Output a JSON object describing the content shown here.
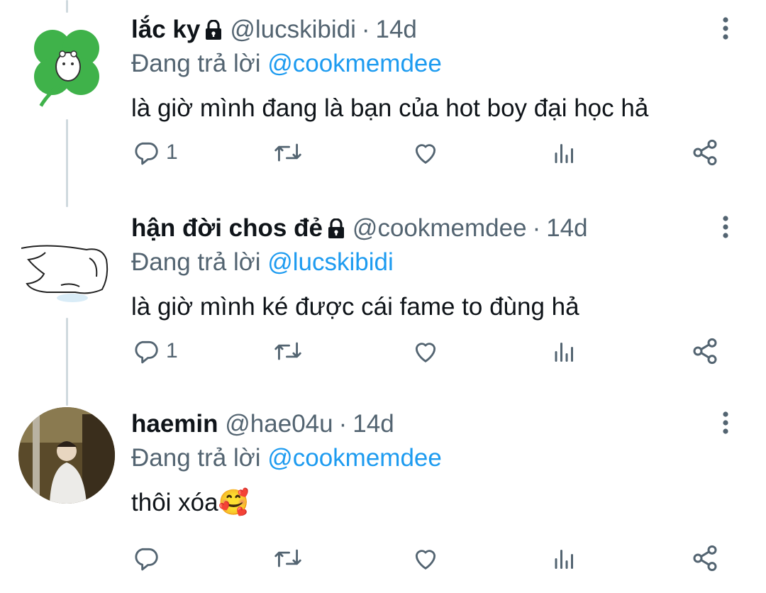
{
  "tweets": [
    {
      "name": "lắc ky",
      "locked": true,
      "handle": "@lucskibidi",
      "time": "14d",
      "reply_prefix": "Đang trả lời",
      "reply_to": "@cookmemdee",
      "text": "là giờ mình đang là bạn của hot boy đại học hả",
      "reply_count": "1",
      "avatar_icon": "clover-avatar-icon"
    },
    {
      "name": "hận đời chos đẻ",
      "locked": true,
      "handle": "@cookmemdee",
      "time": "14d",
      "reply_prefix": "Đang trả lời",
      "reply_to": "@lucskibidi",
      "text": "là giờ mình ké được cái fame to đùng hả",
      "reply_count": "1",
      "avatar_icon": "sketch-avatar-icon"
    },
    {
      "name": "haemin",
      "locked": false,
      "handle": "@hae04u",
      "time": "14d",
      "reply_prefix": "Đang trả lời",
      "reply_to": "@cookmemdee",
      "text": "thôi xóa",
      "emoji": "🥰",
      "reply_count": "",
      "avatar_icon": "photo-avatar-icon"
    }
  ],
  "separator": "·",
  "colors": {
    "mention": "#1d9bf0",
    "secondary": "#536471",
    "thread": "#cfd9de"
  }
}
